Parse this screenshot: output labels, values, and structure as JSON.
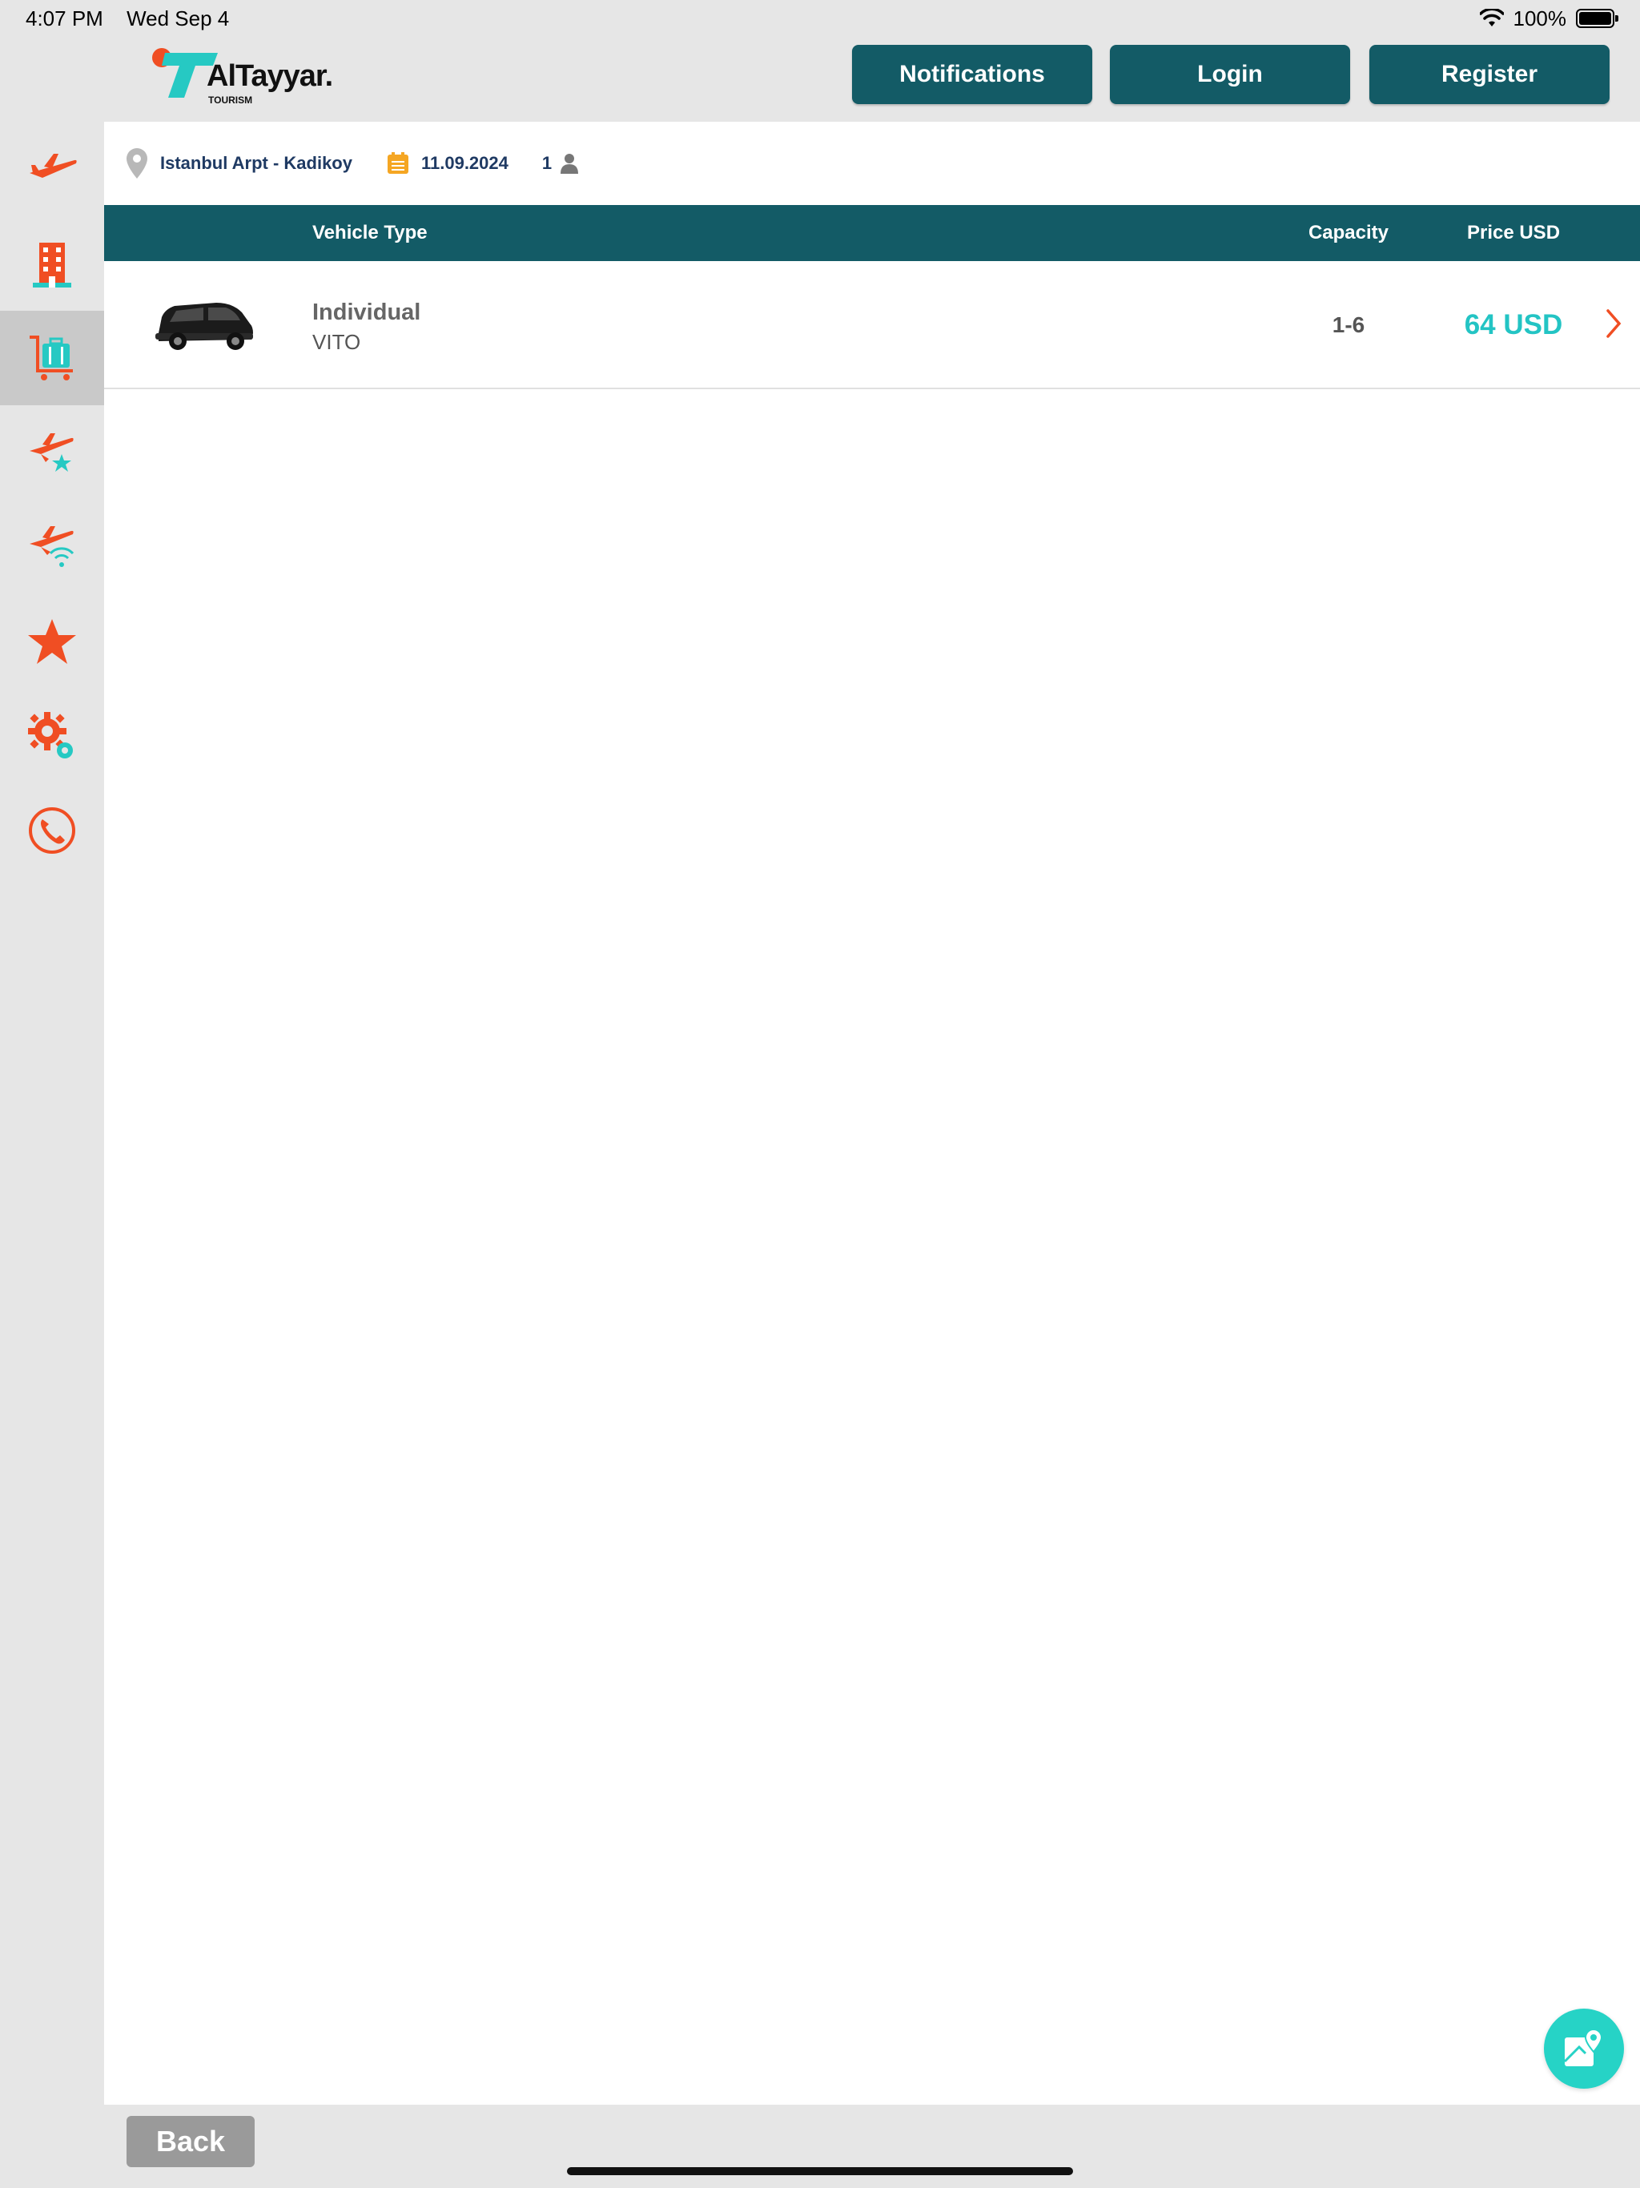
{
  "status_bar": {
    "time": "4:07 PM",
    "date": "Wed Sep 4",
    "battery": "100%"
  },
  "header": {
    "logo_text": "AlTayyar.",
    "logo_sub": "TOURISM",
    "notifications_label": "Notifications",
    "login_label": "Login",
    "register_label": "Register"
  },
  "sidebar": {
    "items": [
      {
        "icon": "airplane-icon"
      },
      {
        "icon": "hotel-icon"
      },
      {
        "icon": "luggage-cart-icon",
        "active": true
      },
      {
        "icon": "flight-hotel-icon"
      },
      {
        "icon": "flight-wifi-icon"
      },
      {
        "icon": "star-icon"
      },
      {
        "icon": "settings-icon"
      },
      {
        "icon": "phone-icon"
      }
    ]
  },
  "search": {
    "route": "Istanbul Arpt - Kadikoy",
    "date": "11.09.2024",
    "passengers": "1"
  },
  "table": {
    "headers": {
      "vehicle_type": "Vehicle Type",
      "capacity": "Capacity",
      "price": "Price USD"
    },
    "rows": [
      {
        "type": "Individual",
        "model": "VITO",
        "capacity": "1-6",
        "price": "64 USD"
      }
    ]
  },
  "footer": {
    "back_label": "Back"
  },
  "colors": {
    "primary": "#135b66",
    "accent": "#f04e23",
    "teal": "#23c4c4",
    "navy": "#1f3a63"
  }
}
